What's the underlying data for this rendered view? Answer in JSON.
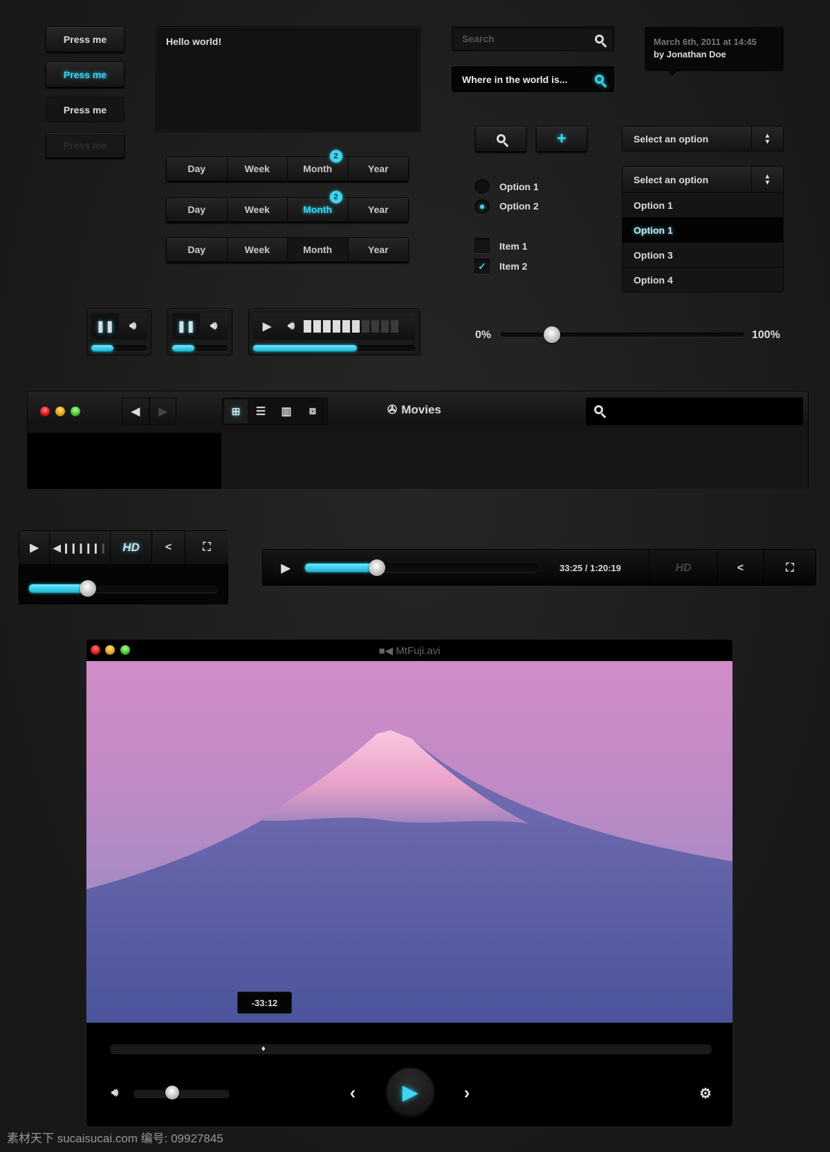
{
  "buttons": [
    "Press me",
    "Press me",
    "Press me",
    "Press me"
  ],
  "textarea": {
    "value": "Hello world!"
  },
  "segmented": [
    {
      "items": [
        "Day",
        "Week",
        "Month",
        "Year"
      ],
      "badge": "2",
      "active": "Month",
      "state": "badge"
    },
    {
      "items": [
        "Day",
        "Week",
        "Month",
        "Year"
      ],
      "badge": "2",
      "active": "Month",
      "state": "glow"
    },
    {
      "items": [
        "Day",
        "Week",
        "Month",
        "Year"
      ],
      "active": "Month",
      "state": "pressed"
    }
  ],
  "search1": {
    "placeholder": "Search"
  },
  "search2": {
    "value": "Where in the world is..."
  },
  "tooltip": {
    "date": "March 6th, 2011 at 14:45",
    "author": "by Jonathan Doe"
  },
  "icon_buttons": {
    "search": "search-icon",
    "add": "+"
  },
  "select1": {
    "value": "Select an option"
  },
  "select2": {
    "value": "Select an option",
    "options": [
      "Option 1",
      "Option 1",
      "Option 3",
      "Option 4"
    ],
    "highlighted_index": 1
  },
  "radios": {
    "items": [
      "Option 1",
      "Option 2"
    ],
    "selected": "Option 2"
  },
  "checkboxes": {
    "items": [
      "Item 1",
      "Item 2"
    ],
    "checked": [
      "Item 2"
    ],
    "checkmark": "✓"
  },
  "slider": {
    "min_label": "0%",
    "max_label": "100%",
    "value": 21
  },
  "mini_players": [
    {
      "progress": 40
    },
    {
      "progress": 40
    },
    {
      "progress": 64,
      "volume_bars_on": 6,
      "volume_bars_total": 10
    }
  ],
  "finder": {
    "title": "Movies"
  },
  "player_small": {
    "hd": "HD",
    "progress": 31
  },
  "player_wide": {
    "time": "33:25 / 1:20:19",
    "hd": "HD",
    "progress": 31
  },
  "video": {
    "title": "MtFuji.avi",
    "tooltip": "-33:12",
    "scrub": 25.5,
    "volume": 40
  },
  "watermark": "素材天下 sucaisucai.com  编号: 09927845",
  "colors": {
    "accent": "#3fd5ee",
    "background": "#1c1c1c"
  }
}
